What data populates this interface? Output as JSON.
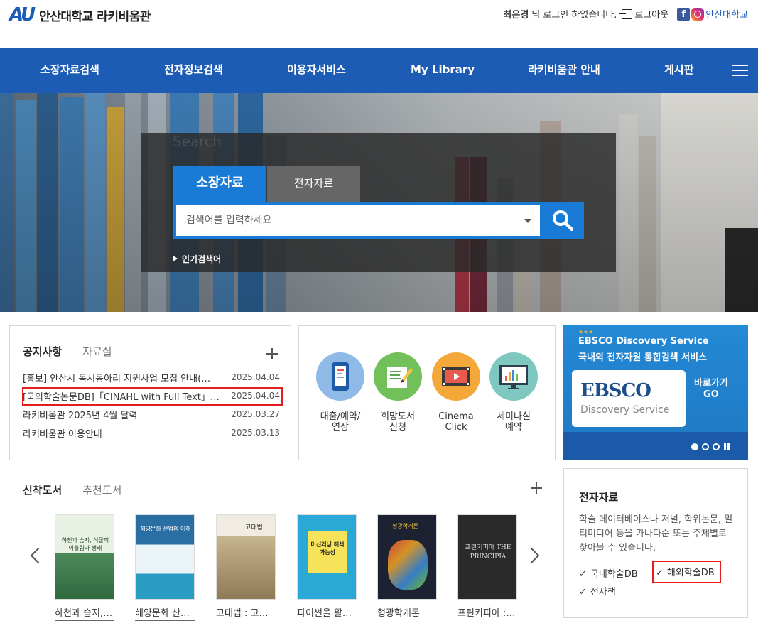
{
  "header": {
    "logo_mark": "AU",
    "site_title": "안산대학교 라키비움관",
    "user_name": "최은경",
    "login_msg": "님 로그인 하였습니다.",
    "logout_label": "로그아웃",
    "sns_label": "안산대학교"
  },
  "nav": {
    "items": [
      "소장자료검색",
      "전자정보검색",
      "이용자서비스",
      "My Library",
      "라키비움관 안내",
      "게시판"
    ]
  },
  "search": {
    "ghost_label": "Search",
    "tab_holdings": "소장자료",
    "tab_electronic": "전자자료",
    "placeholder": "검색어를 입력하세요",
    "popular_label": "인기검색어"
  },
  "notice": {
    "tab_active": "공지사항",
    "tab_other": "자료실",
    "rows": [
      {
        "title": "[홍보] 안산시 독서동아리 지원사업 모집 안내(…",
        "date": "2025.04.04"
      },
      {
        "title": "[국외학술논문DB]「CINAHL with Full Text」…",
        "date": "2025.04.04"
      },
      {
        "title": "라키비움관 2025년 4월 달력",
        "date": "2025.03.27"
      },
      {
        "title": "라키비움관 이용안내",
        "date": "2025.03.13"
      }
    ]
  },
  "services": [
    {
      "label1": "대출/예약/",
      "label2": "연장",
      "icon": "mobile-icon",
      "color": "#8fb9e6"
    },
    {
      "label1": "희망도서",
      "label2": "신청",
      "icon": "book-request-icon",
      "color": "#72c05a"
    },
    {
      "label1": "Cinema",
      "label2": "Click",
      "icon": "film-icon",
      "color": "#f5a83a"
    },
    {
      "label1": "세미나실",
      "label2": "예약",
      "icon": "monitor-chart-icon",
      "color": "#7ec8c0"
    }
  ],
  "ebsco": {
    "stars": "★★★",
    "heading": "EBSCO Discovery Service",
    "subheading": "국내외 전자자원 통합검색 서비스",
    "logo": "EBSCO",
    "discovery": "Discovery Service",
    "go_line1": "바로가기",
    "go_line2": "GO"
  },
  "newbooks": {
    "tab_active": "신착도서",
    "tab_other": "추천도서",
    "books": [
      {
        "title": "하천과 습지, …",
        "cover": "#3f7f4f",
        "cover_text": "하천과 습지, 식물의 어울림과 생태"
      },
      {
        "title": "해양문화 산…",
        "cover": "#2a6fa3",
        "cover_text": "해양문화 산업의 이해"
      },
      {
        "title": "고대법 : 고대…",
        "cover": "#d9cdb4",
        "cover_text": "고대법"
      },
      {
        "title": "파이썬을 활…",
        "cover": "#2aa9d6",
        "cover_text": "머신러닝 해석 가능성"
      },
      {
        "title": "형광학개론",
        "cover": "#1d2233",
        "cover_text": "형광학개론"
      },
      {
        "title": "프린키피아 : …",
        "cover": "#2a2a2a",
        "cover_text": "프린키피아 THE PRINCIPIA"
      }
    ]
  },
  "eres": {
    "title": "전자자료",
    "description": "학술 데이터베이스나 저널, 학위논문, 멀티미디어 등을 가나다순 또는 주제별로 찾아볼 수 있습니다.",
    "links": [
      "국내학술DB",
      "해외학술DB",
      "전자책"
    ]
  }
}
